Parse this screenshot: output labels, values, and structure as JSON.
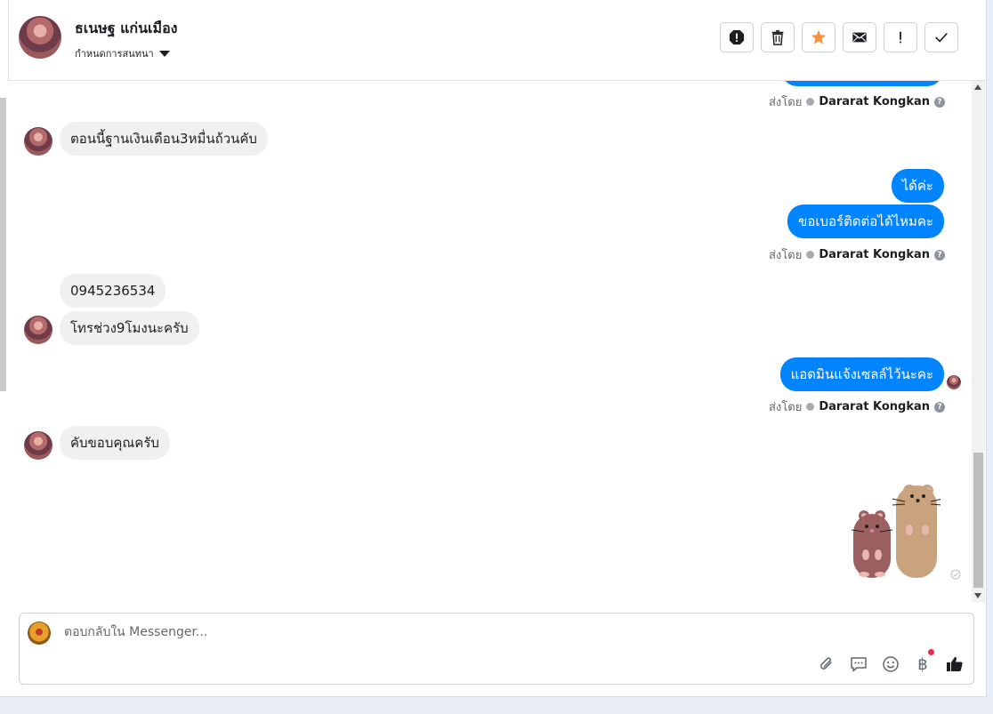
{
  "header": {
    "contact_name": "ธเนษฐ แก่นเมือง",
    "assign_label": "กำหนดการสนทนา",
    "actions": [
      {
        "name": "spam",
        "icon": "alert-octagon-icon"
      },
      {
        "name": "delete",
        "icon": "trash-icon"
      },
      {
        "name": "star",
        "icon": "star-icon",
        "color": "#f7923b"
      },
      {
        "name": "mark-unread",
        "icon": "envelope-icon"
      },
      {
        "name": "follow-up",
        "icon": "exclamation-icon"
      },
      {
        "name": "done",
        "icon": "check-icon"
      }
    ]
  },
  "messages": [
    {
      "id": "m1",
      "direction": "in",
      "text": "ตอนนี้ฐานเงินเดือน3หมื่นถ้วนคับ"
    },
    {
      "id": "m2",
      "direction": "out",
      "text": "ได้ค่ะ"
    },
    {
      "id": "m3",
      "direction": "out",
      "text": "ขอเบอร์ติดต่อได้ไหมคะ"
    },
    {
      "id": "m4",
      "direction": "in",
      "text": "0945236534"
    },
    {
      "id": "m5",
      "direction": "in",
      "text": "โทรช่วง9โมงนะครับ"
    },
    {
      "id": "m6",
      "direction": "out",
      "text": "แอดมินแจ้งเซลล์ไว้นะคะ"
    },
    {
      "id": "m7",
      "direction": "in",
      "text": "คับขอบคุณครับ"
    },
    {
      "id": "m8",
      "direction": "out",
      "sticker": "two-mice-sticker"
    }
  ],
  "sent_by": {
    "prefix": "ส่งโดย",
    "agent": "Dararat Kongkan"
  },
  "composer": {
    "placeholder": "ตอบกลับใน Messenger...",
    "tools": [
      "paperclip-icon",
      "saved-reply-icon",
      "emoji-icon",
      "baht-icon",
      "thumbs-up-icon"
    ],
    "baht_symbol": "฿"
  },
  "colors": {
    "outgoing": "#0084ff",
    "incoming": "#f0f0f0",
    "star": "#f7923b"
  }
}
